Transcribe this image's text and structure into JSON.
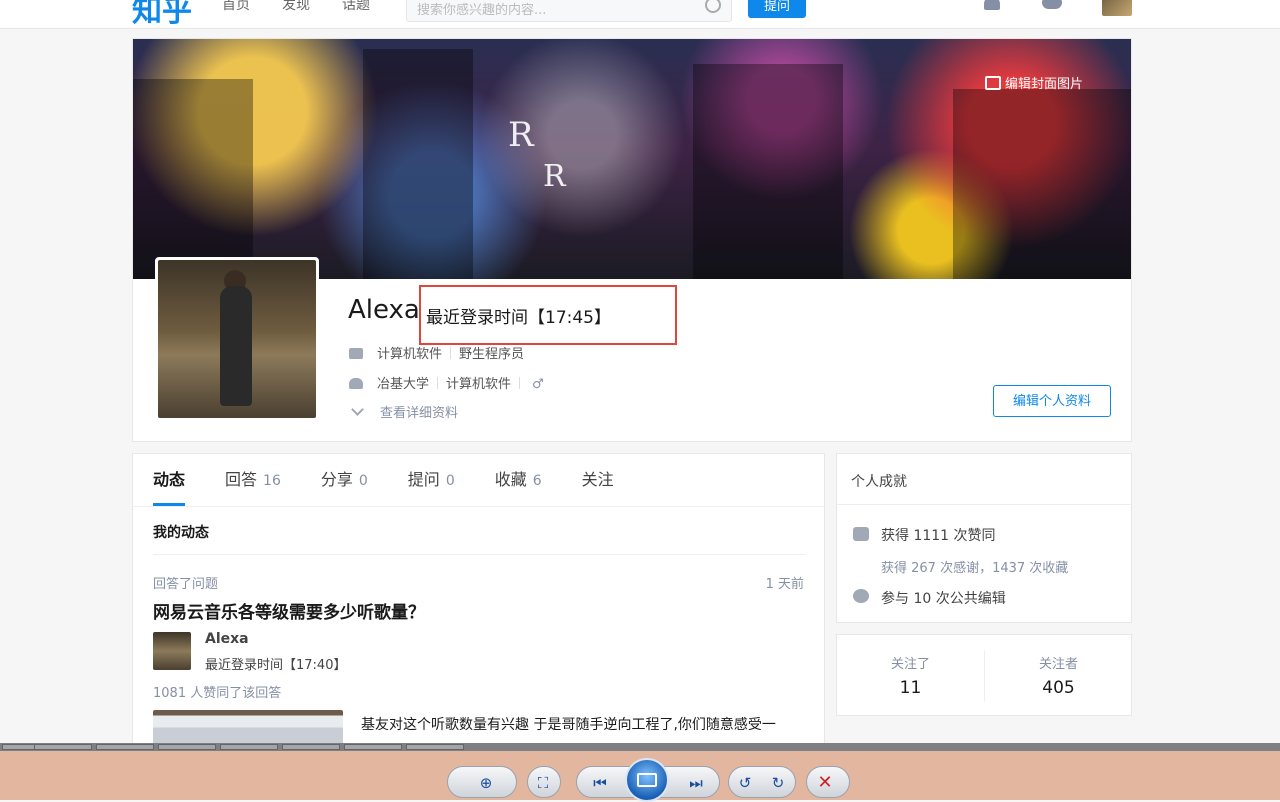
{
  "topbar": {
    "logo": "知乎",
    "nav": [
      "首页",
      "发现",
      "话题"
    ],
    "search_placeholder": "搜索你感兴趣的内容...",
    "ask_label": "提问"
  },
  "profile": {
    "cover_edit_label": "编辑封面图片",
    "name": "Alexa",
    "last_login": "最近登录时间【17:45】",
    "employment": [
      "计算机软件",
      "野生程序员"
    ],
    "education": [
      "冶基大学",
      "计算机软件"
    ],
    "gender_symbol": "♂",
    "details_link": "查看详细资料",
    "edit_button": "编辑个人资料"
  },
  "tabs": [
    {
      "label": "动态",
      "count": ""
    },
    {
      "label": "回答",
      "count": "16"
    },
    {
      "label": "分享",
      "count": "0"
    },
    {
      "label": "提问",
      "count": "0"
    },
    {
      "label": "收藏",
      "count": "6"
    },
    {
      "label": "关注",
      "count": ""
    }
  ],
  "feed": {
    "section_title": "我的动态",
    "item": {
      "type": "回答了问题",
      "time": "1 天前",
      "question": "网易云音乐各等级需要多少听歌量？",
      "author_name": "Alexa",
      "author_sub": "最近登录时间【17:40】",
      "votes": "1081 人赞同了该回答",
      "excerpt": "基友对这个听歌数量有兴趣 于是哥随手逆向工程了,你们随意感受一"
    }
  },
  "achievements": {
    "title": "个人成就",
    "likes": "获得 1111 次赞同",
    "thanks": "获得 267 次感谢，1437 次收藏",
    "edits": "参与 10 次公共编辑"
  },
  "follow": {
    "following_label": "关注了",
    "following_count": "11",
    "followers_label": "关注者",
    "followers_count": "405"
  },
  "viewer": {
    "buttons": [
      "zoom-icon",
      "fit-icon",
      "prev-icon",
      "slideshow-icon",
      "next-icon",
      "rotate-left-icon",
      "rotate-right-icon",
      "delete-icon"
    ]
  }
}
